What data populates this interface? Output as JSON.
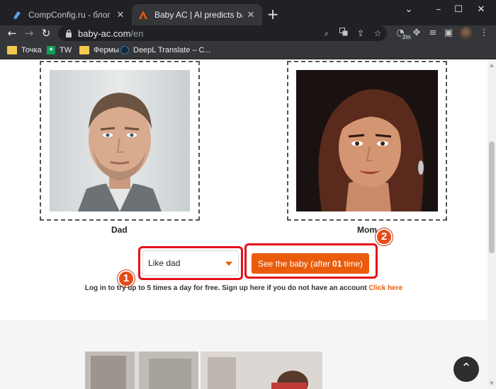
{
  "browser": {
    "tabs": [
      {
        "title": "CompConfig.ru - блог о настрой",
        "active": false
      },
      {
        "title": "Baby AC | AI predicts baby's fac",
        "active": true
      }
    ],
    "new_tab_label": "+",
    "window_controls": {
      "minimize": "–",
      "maximize": "☐",
      "close": "✕"
    },
    "address": {
      "domain": "baby-ac.com",
      "path": "/en"
    },
    "extension_badge": "2m",
    "bookmarks": [
      {
        "label": "Точка",
        "icon": "folder-icon"
      },
      {
        "label": "TW",
        "icon": "tw-icon"
      },
      {
        "label": "Фермы",
        "icon": "folder-icon"
      },
      {
        "label": "DeepL Translate – C...",
        "icon": "deepl-icon"
      }
    ]
  },
  "page": {
    "dad_label": "Dad",
    "mom_label": "Mom",
    "select": {
      "value": "Like dad"
    },
    "see_button": {
      "prefix": "See the baby (after",
      "count": "01",
      "suffix": "time)"
    },
    "login_note": {
      "text": "Log in to try up to 5 times a day for free. Sign up here if you do not have an account",
      "link": "Click here"
    },
    "back_to_top_icon": "arrow-up-icon"
  },
  "annotations": {
    "markers": [
      "1",
      "2"
    ],
    "highlight_color": "#e3111b"
  },
  "colors": {
    "accent": "#ea5b0c",
    "chrome_dark": "#202124",
    "chrome_toolbar": "#35363a"
  }
}
